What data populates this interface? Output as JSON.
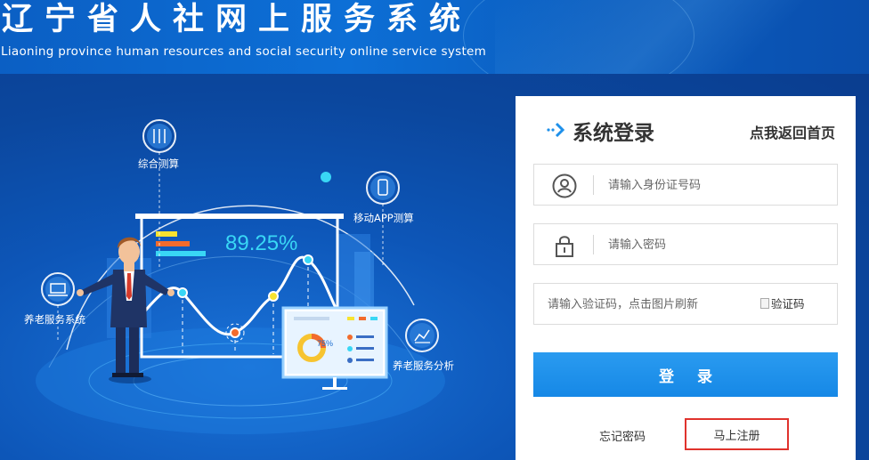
{
  "header": {
    "title_cn": "辽宁省人社网上服务系统",
    "title_en": "Liaoning province human resources and social security online service system"
  },
  "illustration": {
    "percent_text": "89.25%",
    "donut_text": "75%",
    "nodes": {
      "calc": "综合测算",
      "mobile": "移动APP测算",
      "pension_system": "养老服务系统",
      "pension_analysis": "养老服务分析"
    }
  },
  "login": {
    "title": "系统登录",
    "home_link": "点我返回首页",
    "id_placeholder": "请输入身份证号码",
    "password_placeholder": "请输入密码",
    "captcha_placeholder": "请输入验证码，点击图片刷新",
    "captcha_alt": "验证码",
    "submit_label": "登 录",
    "forgot_label": "忘记密码",
    "register_label": "马上注册"
  },
  "colors": {
    "header_blue": "#0d6fd6",
    "hero_blue": "#0d56b8",
    "button_blue": "#1e90ea",
    "register_border": "#e0332d",
    "accent_cyan": "#39d7f5"
  }
}
